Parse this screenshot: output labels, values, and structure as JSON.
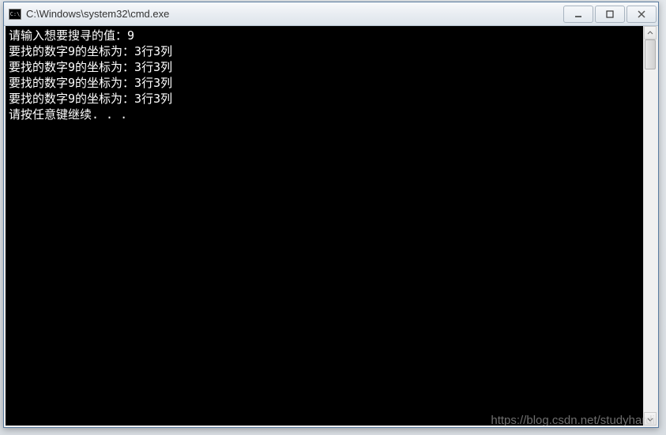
{
  "window": {
    "title": "C:\\Windows\\system32\\cmd.exe",
    "icon_label": "cmd-icon"
  },
  "controls": {
    "minimize": "minimize",
    "maximize": "maximize",
    "close": "close"
  },
  "console": {
    "lines": [
      "请输入想要搜寻的值：9",
      "要找的数字9的坐标为：3行3列",
      "要找的数字9的坐标为：3行3列",
      "要找的数字9的坐标为：3行3列",
      "要找的数字9的坐标为：3行3列",
      "请按任意键继续. . ."
    ]
  },
  "watermark": "https://blog.csdn.net/studyhardi"
}
